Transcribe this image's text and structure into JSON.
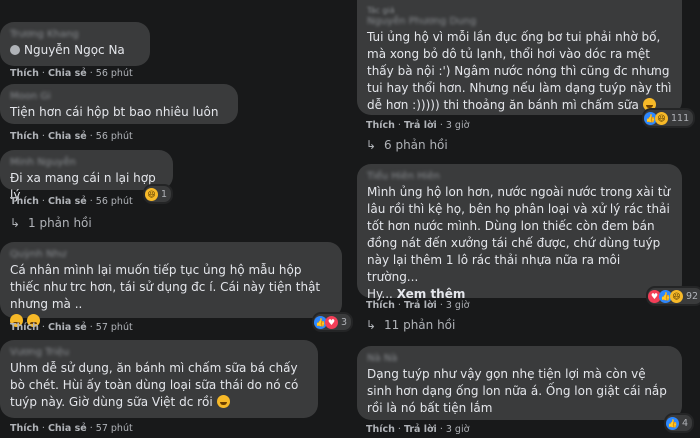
{
  "left": [
    {
      "author": "Trương Khang",
      "mention": "Nguyễn Ngọc Na",
      "actions": {
        "like": "Thích",
        "share": "Chia sẻ",
        "time": "56 phút"
      }
    },
    {
      "author": "Moon Gi",
      "text": "Tiện hơn cái hộp bt bao nhiêu luôn",
      "actions": {
        "like": "Thích",
        "share": "Chia sẻ",
        "time": "56 phút"
      }
    },
    {
      "author": "Minh Nguyễn",
      "text": "Đi xa mang cái n lại hợp lý",
      "actions": {
        "like": "Thích",
        "share": "Chia sẻ",
        "time": "56 phút"
      },
      "reaction_count": "1",
      "replies": "1 phản hồi"
    },
    {
      "author": "Quỳnh Như",
      "text": "Cá nhân mình lại muốn tiếp tục ủng hộ mẫu hộp thiếc như trc hơn, tái sử dụng đc í. Cái này tiện thật nhưng mà ..",
      "actions": {
        "like": "Thích",
        "share": "Chia sẻ",
        "time": "57 phút"
      },
      "reaction_count": "3"
    },
    {
      "author": "Vương Triệu",
      "text": "Uhm dễ sử dụng, ăn bánh mì chấm sữa bá chấy bò chét. Hùi ấy toàn dùng loại sữa thái do nó có tuýp này. Giờ dùng sữa Việt dc rồi",
      "actions": {
        "like": "Thích",
        "share": "Chia sẻ",
        "time": "57 phút"
      }
    }
  ],
  "right": [
    {
      "top_label": "Tác giả",
      "author": "Nguyễn Phương Dung",
      "text": "Tui ủng hộ vì mỗi lần đục ống bơ tui phải nhờ bố, mà xong bỏ dô tủ lạnh, thổi hơi vào dóc ra mệt thấy bà nội :') Ngâm nước nóng thì cũng đc nhưng tui hay thổi hơn. Nhưng nếu làm dạng tuýp này thì dễ hơn :))))) thi thoảng ăn bánh mì chấm sữa",
      "actions": {
        "like": "Thích",
        "reply": "Trả lời",
        "time": "3 giờ"
      },
      "reaction_count": "111",
      "replies": "6 phản hồi"
    },
    {
      "author": "Tiểu Hiên Hiên",
      "text": "Mình ủng hộ lon hơn, nước ngoài nước trong xài từ lâu rồi thì kệ họ, bên họ phân loại và xử lý rác thải tốt hơn nước mình. Dùng lon thiếc còn đem bán đồng nát đến xưởng tái chế được, chứ dùng tuýp này lại thêm 1 lô rác thải nhựa nữa ra môi trường...",
      "text_tail": "Hy...",
      "see_more": "Xem thêm",
      "actions": {
        "like": "Thích",
        "reply": "Trả lời",
        "time": "3 giờ"
      },
      "reaction_count": "92",
      "replies": "11 phản hồi"
    },
    {
      "author": "Nà Nà",
      "text": "Dạng tuýp như vậy gọn nhẹ tiện lợi mà còn vệ sinh hơn dạng ống lon nữa á. Ống lon giật cái nắp rồi là nó bất tiện lắm",
      "actions": {
        "like": "Thích",
        "reply": "Trả lời",
        "time": "3 giờ"
      },
      "reaction_count": "4"
    }
  ],
  "colors": {
    "bg": "#18191a",
    "bubble": "#3a3b3c",
    "text": "#e4e6eb",
    "muted": "#b0b3b8",
    "like": "#2d88ff",
    "haha": "#f7b928",
    "love": "#f33e58"
  }
}
